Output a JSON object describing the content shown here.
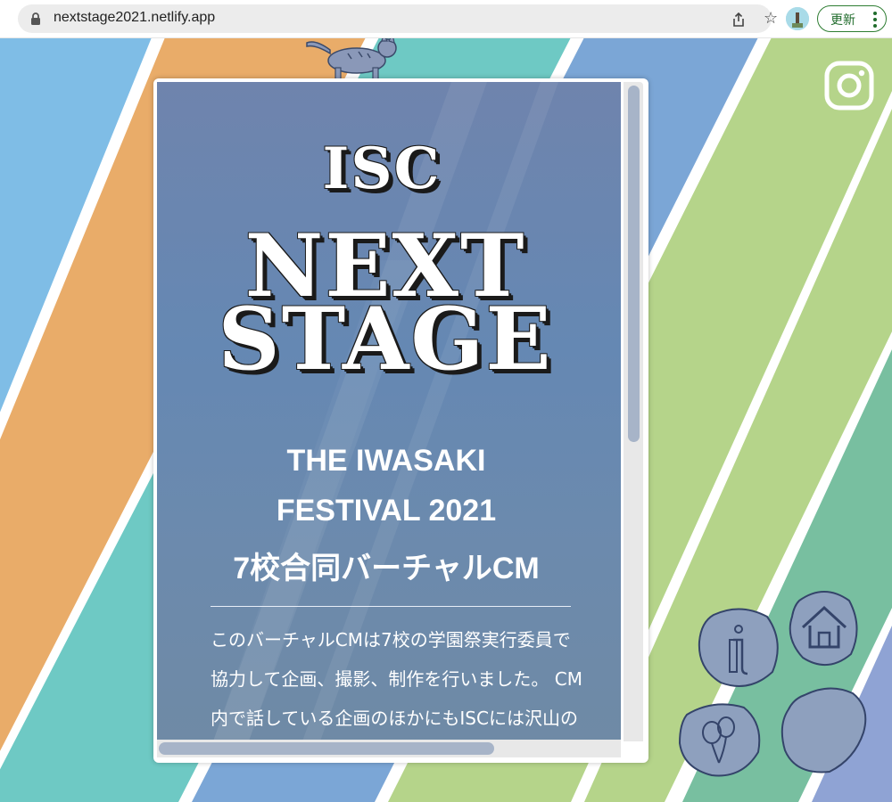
{
  "browser": {
    "url": "nextstage2021.netlify.app",
    "update_label": "更新"
  },
  "site": {
    "title_line1": "ISC",
    "title_line2": "NEXT",
    "title_line3": "STAGE",
    "subtitle_line1": "THE IWASAKI",
    "subtitle_line2": "FESTIVAL 2021",
    "subtitle_line3": "7校合同バーチャルCM",
    "description": "このバーチャルCMは7校の学園祭実行委員で協力して企画、撮影、制作を行いました。 CM内で話している企画のほかにもISCには沢山の企画がありますし、続編も"
  },
  "nav": {
    "icons": [
      "instagram-icon",
      "info-icon",
      "home-icon",
      "balloon-icon",
      "paw-icon"
    ]
  },
  "colors": {
    "stripe_blue": "#7fbde6",
    "stripe_orange": "#e9ac69",
    "stripe_teal": "#6ec9c4",
    "stripe_green": "#b5d48a",
    "stripe_seagreen": "#78bfa0",
    "card_bg": "#6a87b0",
    "accent_green": "#2e7d32"
  }
}
